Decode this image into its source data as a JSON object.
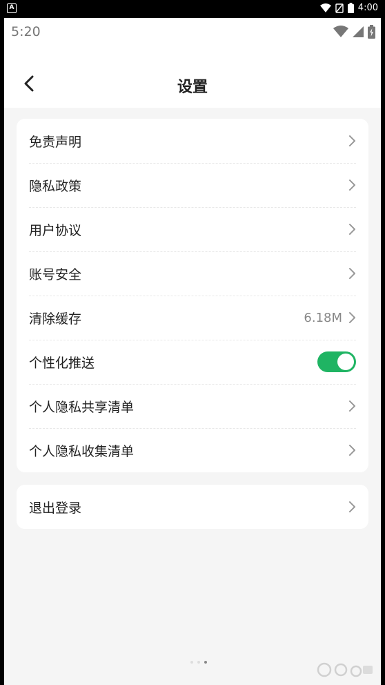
{
  "system_bar": {
    "time": "4:00"
  },
  "app_status": {
    "time": "5:20"
  },
  "header": {
    "title": "设置"
  },
  "settings": {
    "items": [
      {
        "label": "免责声明"
      },
      {
        "label": "隐私政策"
      },
      {
        "label": "用户协议"
      },
      {
        "label": "账号安全"
      },
      {
        "label": "清除缓存",
        "value": "6.18M"
      },
      {
        "label": "个性化推送",
        "toggle": true
      },
      {
        "label": "个人隐私共享清单"
      },
      {
        "label": "个人隐私收集清单"
      }
    ]
  },
  "logout": {
    "label": "退出登录"
  },
  "colors": {
    "toggle_on": "#1fb463",
    "background": "#f5f5f5"
  },
  "icons": [
    "back-arrow-icon",
    "chevron-right-icon",
    "wifi-icon",
    "signal-icon",
    "battery-icon"
  ]
}
